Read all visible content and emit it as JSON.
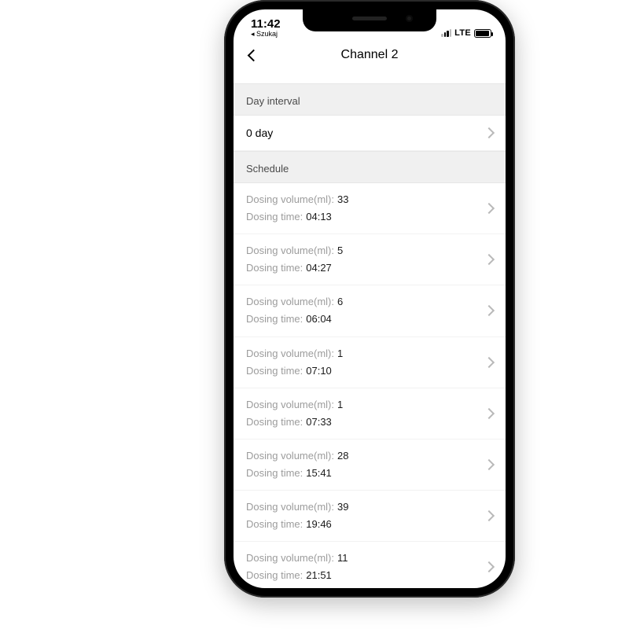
{
  "status": {
    "time": "11:42",
    "back_app": "◂ Szukaj",
    "carrier": "LTE"
  },
  "nav": {
    "title": "Channel 2"
  },
  "interval": {
    "header": "Day interval",
    "value": "0 day"
  },
  "schedule": {
    "header": "Schedule",
    "volume_label": "Dosing volume(ml):",
    "time_label": "Dosing time:",
    "items": [
      {
        "volume": "33",
        "time": "04:13"
      },
      {
        "volume": "5",
        "time": "04:27"
      },
      {
        "volume": "6",
        "time": "06:04"
      },
      {
        "volume": "1",
        "time": "07:10"
      },
      {
        "volume": "1",
        "time": "07:33"
      },
      {
        "volume": "28",
        "time": "15:41"
      },
      {
        "volume": "39",
        "time": "19:46"
      },
      {
        "volume": "11",
        "time": "21:51"
      }
    ]
  }
}
